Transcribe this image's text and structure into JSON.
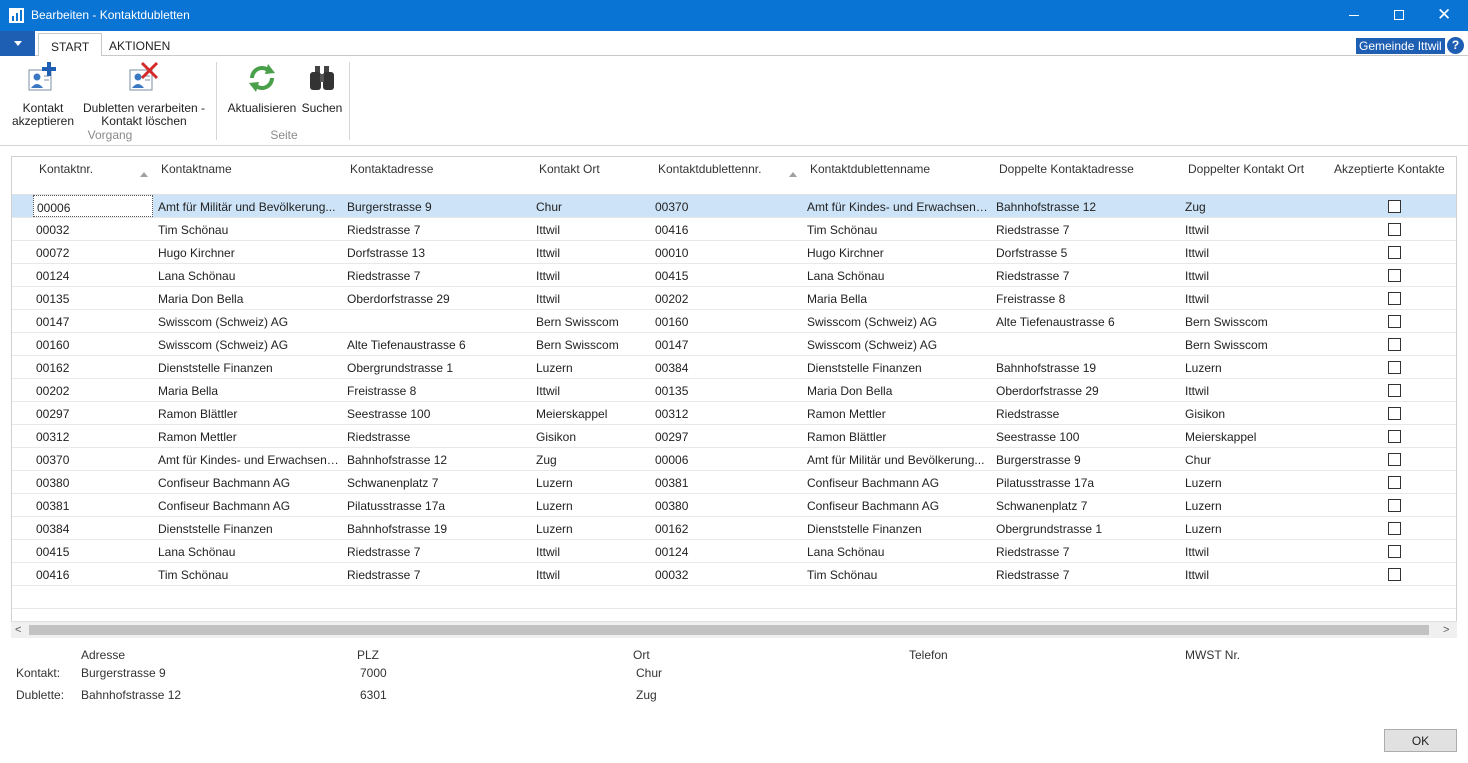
{
  "window": {
    "title": "Bearbeiten - Kontaktdubletten"
  },
  "tabs": [
    {
      "label": "START"
    },
    {
      "label": "AKTIONEN"
    }
  ],
  "company": "Gemeinde Ittwil",
  "ribbon": {
    "accept": {
      "line1": "Kontakt",
      "line2": "akzeptieren"
    },
    "process": {
      "line1": "Dubletten verarbeiten -",
      "line2": "Kontakt löschen"
    },
    "refresh": "Aktualisieren",
    "search": "Suchen",
    "group_vorgang": "Vorgang",
    "group_seite": "Seite"
  },
  "columns": [
    "Kontaktnr.",
    "Kontaktname",
    "Kontaktadresse",
    "Kontakt Ort",
    "Kontaktdublettennr.",
    "Kontaktdublettenname",
    "Doppelte Kontaktadresse",
    "Doppelter Kontakt Ort",
    "Akzeptierte Kontakte"
  ],
  "rows": [
    [
      "00006",
      "Amt für Militär und Bevölkerung...",
      "Burgerstrasse 9",
      "Chur",
      "00370",
      "Amt für Kindes- und Erwachsene...",
      "Bahnhofstrasse 12",
      "Zug"
    ],
    [
      "00032",
      "Tim Schönau",
      "Riedstrasse 7",
      "Ittwil",
      "00416",
      "Tim Schönau",
      "Riedstrasse 7",
      "Ittwil"
    ],
    [
      "00072",
      "Hugo Kirchner",
      "Dorfstrasse 13",
      "Ittwil",
      "00010",
      "Hugo Kirchner",
      "Dorfstrasse 5",
      "Ittwil"
    ],
    [
      "00124",
      "Lana Schönau",
      "Riedstrasse 7",
      "Ittwil",
      "00415",
      "Lana Schönau",
      "Riedstrasse 7",
      "Ittwil"
    ],
    [
      "00135",
      "Maria Don Bella",
      "Oberdorfstrasse 29",
      "Ittwil",
      "00202",
      "Maria Bella",
      "Freistrasse 8",
      "Ittwil"
    ],
    [
      "00147",
      "Swisscom (Schweiz) AG",
      "",
      "Bern Swisscom",
      "00160",
      "Swisscom (Schweiz) AG",
      "Alte Tiefenaustrasse 6",
      "Bern Swisscom"
    ],
    [
      "00160",
      "Swisscom (Schweiz) AG",
      "Alte Tiefenaustrasse 6",
      "Bern Swisscom",
      "00147",
      "Swisscom (Schweiz) AG",
      "",
      "Bern Swisscom"
    ],
    [
      "00162",
      "Dienststelle Finanzen",
      "Obergrundstrasse 1",
      "Luzern",
      "00384",
      "Dienststelle Finanzen",
      "Bahnhofstrasse 19",
      "Luzern"
    ],
    [
      "00202",
      "Maria Bella",
      "Freistrasse 8",
      "Ittwil",
      "00135",
      "Maria Don Bella",
      "Oberdorfstrasse 29",
      "Ittwil"
    ],
    [
      "00297",
      "Ramon Blättler",
      "Seestrasse 100",
      "Meierskappel",
      "00312",
      "Ramon Mettler",
      "Riedstrasse",
      "Gisikon"
    ],
    [
      "00312",
      "Ramon Mettler",
      "Riedstrasse",
      "Gisikon",
      "00297",
      "Ramon Blättler",
      "Seestrasse 100",
      "Meierskappel"
    ],
    [
      "00370",
      "Amt für Kindes- und Erwachsene...",
      "Bahnhofstrasse 12",
      "Zug",
      "00006",
      "Amt für Militär und Bevölkerung...",
      "Burgerstrasse 9",
      "Chur"
    ],
    [
      "00380",
      "Confiseur Bachmann AG",
      "Schwanenplatz 7",
      "Luzern",
      "00381",
      "Confiseur Bachmann AG",
      "Pilatusstrasse 17a",
      "Luzern"
    ],
    [
      "00381",
      "Confiseur Bachmann AG",
      "Pilatusstrasse 17a",
      "Luzern",
      "00380",
      "Confiseur Bachmann AG",
      "Schwanenplatz 7",
      "Luzern"
    ],
    [
      "00384",
      "Dienststelle Finanzen",
      "Bahnhofstrasse 19",
      "Luzern",
      "00162",
      "Dienststelle Finanzen",
      "Obergrundstrasse 1",
      "Luzern"
    ],
    [
      "00415",
      "Lana Schönau",
      "Riedstrasse 7",
      "Ittwil",
      "00124",
      "Lana Schönau",
      "Riedstrasse 7",
      "Ittwil"
    ],
    [
      "00416",
      "Tim Schönau",
      "Riedstrasse 7",
      "Ittwil",
      "00032",
      "Tim Schönau",
      "Riedstrasse 7",
      "Ittwil"
    ]
  ],
  "detail": {
    "headers": [
      "Adresse",
      "PLZ",
      "Ort",
      "Telefon",
      "MWST Nr."
    ],
    "kontakt": {
      "label": "Kontakt:",
      "adresse": "Burgerstrasse 9",
      "plz": "7000",
      "ort": "Chur"
    },
    "dublette": {
      "label": "Dublette:",
      "adresse": "Bahnhofstrasse 12",
      "plz": "6301",
      "ort": "Zug"
    }
  },
  "ok_label": "OK"
}
